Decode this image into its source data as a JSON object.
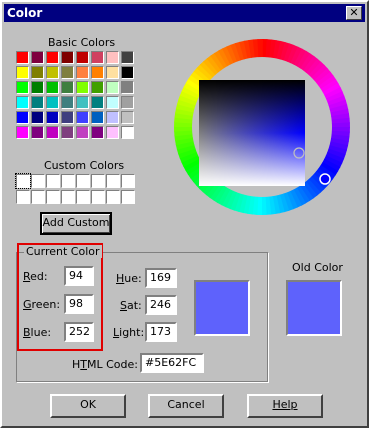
{
  "window": {
    "title": "Color",
    "close_glyph": "✕"
  },
  "basic": {
    "label": "Basic Colors",
    "colors": [
      "#ff0000",
      "#7f003f",
      "#ff0000",
      "#7f0000",
      "#c00000",
      "#d04060",
      "#ffc0c0",
      "#404040",
      "#ffff00",
      "#7f7f00",
      "#c0c000",
      "#7f7f3f",
      "#ff8040",
      "#ff8000",
      "#ffe0a0",
      "#000000",
      "#00ff00",
      "#007f00",
      "#00c000",
      "#3f7f3f",
      "#80ff00",
      "#40a000",
      "#c0ffc0",
      "#808080",
      "#00ffff",
      "#007f7f",
      "#00c0c0",
      "#3f7f7f",
      "#40c0c0",
      "#008080",
      "#c0ffff",
      "#a0a0a0",
      "#0000ff",
      "#00007f",
      "#0000c0",
      "#3f3f7f",
      "#4040ff",
      "#0060c0",
      "#c0c0ff",
      "#c0c0c0",
      "#ff00ff",
      "#7f007f",
      "#c000c0",
      "#7f3f7f",
      "#c040c0",
      "#800080",
      "#ffc0ff",
      "#ffffff"
    ]
  },
  "custom": {
    "label": "Custom Colors",
    "count": 16,
    "add_button": "Add Custom"
  },
  "current": {
    "label": "Current Color",
    "red_label": "Red:",
    "green_label": "Green:",
    "blue_label": "Blue:",
    "red": "94",
    "green": "98",
    "blue": "252",
    "hue_label": "Hue:",
    "sat_label": "Sat:",
    "light_label": "Light:",
    "hue": "169",
    "sat": "246",
    "light": "173",
    "html_label": "HTML Code:",
    "html": "#5E62FC",
    "swatch": "#5e62fc"
  },
  "old": {
    "label": "Old Color",
    "swatch": "#5e62fc"
  },
  "buttons": {
    "ok": "OK",
    "cancel": "Cancel",
    "help": "Help"
  },
  "highlight_color": "#e00000"
}
